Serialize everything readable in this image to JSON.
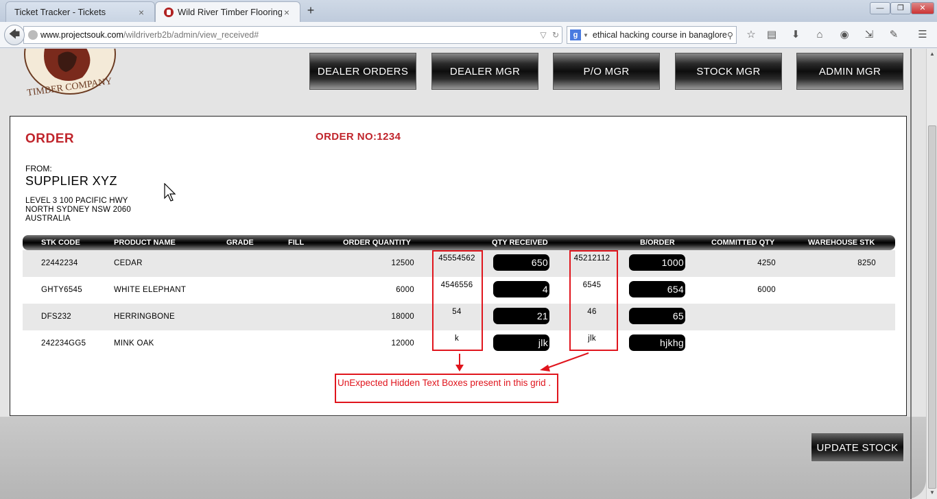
{
  "browser": {
    "tabs": [
      {
        "label": "Ticket Tracker - Tickets",
        "close": "×"
      },
      {
        "label": "Wild River Timber Flooring...",
        "close": "×"
      }
    ],
    "new_tab": "+",
    "url_host": "www.projectsouk.com",
    "url_path": "/wildriverb2b/admin/view_received#",
    "search_engine_letter": "g",
    "search_text": "ethical hacking course in banaglore"
  },
  "nav": {
    "buttons": [
      "DEALER ORDERS",
      "DEALER MGR",
      "P/O MGR",
      "STOCK MGR",
      "ADMIN MGR"
    ]
  },
  "logo": {
    "text": "TIMBER COMPANY"
  },
  "order": {
    "title": "ORDER",
    "order_no": "ORDER NO:1234",
    "from_label": "FROM:",
    "supplier": "SUPPLIER XYZ",
    "address_lines": [
      "LEVEL 3 100 PACIFIC HWY",
      "NORTH SYDNEY NSW 2060",
      "AUSTRALIA"
    ]
  },
  "table": {
    "headers": {
      "stk_code": "STK CODE",
      "product_name": "PRODUCT NAME",
      "grade": "GRADE",
      "fill": "FILL",
      "order_qty": "ORDER QUANTITY",
      "qty_received": "QTY RECEIVED",
      "border": "B/ORDER",
      "committed": "COMMITTED QTY",
      "warehouse": "WAREHOUSE STK"
    },
    "rows": [
      {
        "stk": "22442234",
        "name": "CEDAR",
        "order_qty": "12500",
        "hidden_qty": "45554562",
        "qty_received": "650",
        "hidden_border": "45212112",
        "border": "1000",
        "committed": "4250",
        "warehouse": "8250"
      },
      {
        "stk": "GHTY6545",
        "name": "WHITE ELEPHANT",
        "order_qty": "6000",
        "hidden_qty": "4546556",
        "qty_received": "4",
        "hidden_border": "6545",
        "border": "654",
        "committed": "6000",
        "warehouse": ""
      },
      {
        "stk": "DFS232",
        "name": "HERRINGBONE",
        "order_qty": "18000",
        "hidden_qty": "54",
        "qty_received": "21",
        "hidden_border": "46",
        "border": "65",
        "committed": "",
        "warehouse": ""
      },
      {
        "stk": "242234GG5",
        "name": "MINK OAK",
        "order_qty": "12000",
        "hidden_qty": "k",
        "qty_received": "jlk",
        "hidden_border": "jlk",
        "border": "hjkhg",
        "committed": "",
        "warehouse": ""
      }
    ]
  },
  "annotation": {
    "text": "UnExpected Hidden Text Boxes present in this grid .",
    "color": "#e0141c"
  },
  "update_button": "UPDATE STOCK",
  "colors": {
    "accent_red": "#c0242b",
    "page_bg": "#e4e4e4"
  }
}
